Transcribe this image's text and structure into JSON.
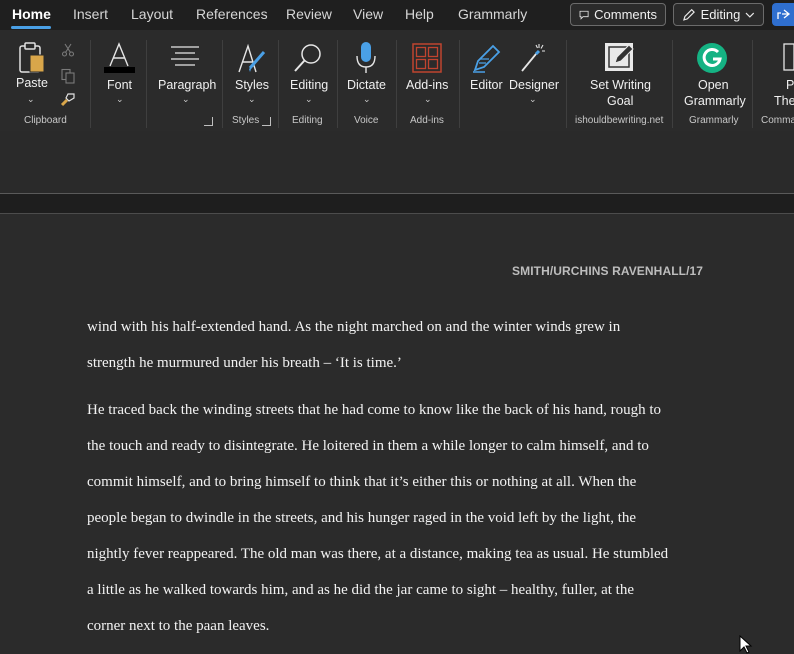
{
  "tabs": [
    {
      "label": "Home"
    },
    {
      "label": "Insert"
    },
    {
      "label": "Layout"
    },
    {
      "label": "References"
    },
    {
      "label": "Review"
    },
    {
      "label": "View"
    },
    {
      "label": "Help"
    },
    {
      "label": "Grammarly"
    }
  ],
  "topbar": {
    "comments_label": "Comments",
    "editing_label": "Editing"
  },
  "ribbon": {
    "paste": "Paste",
    "font": "Font",
    "paragraph": "Paragraph",
    "styles": "Styles",
    "editing": "Editing",
    "dictate": "Dictate",
    "addins": "Add-ins",
    "editor": "Editor",
    "designer": "Designer",
    "set_writing_goal_1": "Set Writing",
    "set_writing_goal_2": "Goal",
    "open_grammarly_1": "Open",
    "open_grammarly_2": "Grammarly",
    "partial_1": "Po",
    "partial_2": "The"
  },
  "groups": {
    "clipboard": "Clipboard",
    "styles": "Styles",
    "editing": "Editing",
    "voice": "Voice",
    "addins": "Add-ins",
    "ishouldbewriting": "ishouldbewriting.net",
    "grammarly": "Grammarly",
    "commands": "Comma"
  },
  "colors": {
    "accent": "#4aa0e6",
    "font_color_bar": "#000000",
    "addins_icon": "#c0442f",
    "grammarly_green": "#15b283",
    "share_blue": "#2f6fcf"
  },
  "document": {
    "running_header": "SMITH/URCHINS RAVENHALL/17",
    "lines": [
      "wind with his half-extended hand. As the night marched on and the winter winds grew in",
      "strength he murmured under his breath – ‘It is time.’",
      "He traced back the winding streets that he had come to know like the back of his hand, rough to",
      "the touch and ready to disintegrate. He loitered in them a while longer to calm himself, and to",
      "commit himself, and to bring himself to think that it’s either this or nothing at all. When the",
      "people began to dwindle in the streets, and his hunger raged in the void left by the light, the",
      "nightly fever reappeared. The old man was there, at a distance, making tea as usual. He stumbled",
      "a little as he walked towards him, and as he did the jar came to sight – healthy, fuller, at the",
      "corner next to the paan leaves."
    ]
  }
}
